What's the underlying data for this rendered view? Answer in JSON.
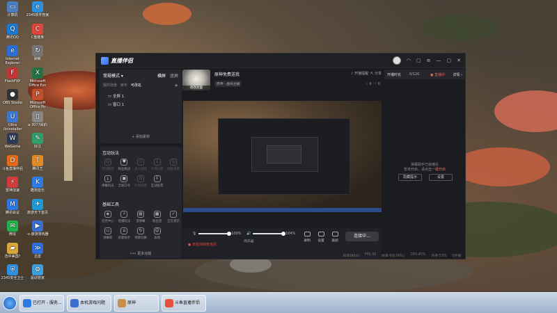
{
  "desktop": {
    "icons": [
      {
        "label": "计算机",
        "name": "computer-icon",
        "glyph": "▭",
        "color": "#4c7fc2"
      },
      {
        "label": "2345软件管家",
        "name": "software-manager-icon",
        "glyph": "e",
        "color": "#2f8fe0"
      },
      {
        "label": "腾讯QQ",
        "name": "qq-icon",
        "glyph": "Q",
        "color": "#1a7ad1"
      },
      {
        "label": "C盘瘦身",
        "name": "disk-cleanup-icon",
        "glyph": "C",
        "color": "#e0453a"
      },
      {
        "label": "Internet Explorer",
        "name": "ie-icon",
        "glyph": "e",
        "color": "#2a6fd6"
      },
      {
        "label": "刷新",
        "name": "refresh-icon",
        "glyph": "↻",
        "color": "#777"
      },
      {
        "label": "FlashFXP",
        "name": "flashfxp-icon",
        "glyph": "F",
        "color": "#c23535"
      },
      {
        "label": "Microsoft Office Exc",
        "name": "excel-icon",
        "glyph": "X",
        "color": "#217346"
      },
      {
        "label": "OBS Studio",
        "name": "obs-icon",
        "glyph": "●",
        "color": "#333"
      },
      {
        "label": "Microsoft Office Po",
        "name": "powerpoint-icon",
        "glyph": "P",
        "color": "#c4502b"
      },
      {
        "label": "Ultra Uninstaller",
        "name": "uninstaller-icon",
        "glyph": "U",
        "color": "#3b78d0"
      },
      {
        "label": "a-3077尚的",
        "name": "file-icon",
        "glyph": "▯",
        "color": "#888"
      },
      {
        "label": "WeGame",
        "name": "wegame-icon",
        "glyph": "W",
        "color": "#2d3a55"
      },
      {
        "label": "好注",
        "name": "note-icon",
        "glyph": "✎",
        "color": "#2f9f6d"
      },
      {
        "label": "斗鱼直播伴侣",
        "name": "douyu-icon",
        "glyph": "D",
        "color": "#e56a1a"
      },
      {
        "label": "腾讯王",
        "name": "tencent-app-icon",
        "glyph": "T",
        "color": "#e38b24"
      },
      {
        "label": "雷神加速",
        "name": "accelerator-icon",
        "glyph": "⚡",
        "color": "#d23b3b"
      },
      {
        "label": "酷狗音乐",
        "name": "kugou-icon",
        "glyph": "K",
        "color": "#2b7de9"
      },
      {
        "label": "腾讯会议",
        "name": "meeting-icon",
        "glyph": "M",
        "color": "#2e77e6"
      },
      {
        "label": "旅游天下首页",
        "name": "travel-icon",
        "glyph": "✈",
        "color": "#1e9bd7"
      },
      {
        "label": "微信",
        "name": "wechat-icon",
        "glyph": "✉",
        "color": "#21b24b"
      },
      {
        "label": "-x-旅游游戏器",
        "name": "game-launcher-icon",
        "glyph": "▶",
        "color": "#3a6fd0"
      },
      {
        "label": "选中美国?",
        "name": "folder-icon",
        "glyph": "▰",
        "color": "#d8a63a"
      },
      {
        "label": "迅雷",
        "name": "xunlei-icon",
        "glyph": "≫",
        "color": "#2c6ee0"
      },
      {
        "label": "2345安全卫士",
        "name": "security-icon",
        "glyph": "⛨",
        "color": "#2f8fe0"
      },
      {
        "label": "驱动管家",
        "name": "driver-icon",
        "glyph": "⚙",
        "color": "#3aa1e0"
      }
    ]
  },
  "app": {
    "title": "直播伴侣",
    "window_controls": {
      "headset": "◠",
      "chat": "▢",
      "menu": "≡",
      "minimize": "—",
      "maximize": "▢",
      "close": "✕"
    },
    "left": {
      "mode_label": "常规模式 ▾",
      "mode_tabs": [
        "横屏",
        "竖屏"
      ],
      "sub_tabs": [
        "我的场景",
        "荣布",
        "可改名"
      ],
      "plus": "+",
      "scenes": [
        "全屏 1",
        "窗口 1"
      ],
      "add_source": "+ 添加素材",
      "interactive_title": "互动玩法",
      "interactive_tools": [
        {
          "label": "连线管理",
          "glyph": "☺",
          "dim": true
        },
        {
          "label": "粉丝挑战",
          "glyph": "⛊",
          "dim": false
        },
        {
          "label": "多人连线",
          "glyph": "⚇",
          "dim": true
        },
        {
          "label": "礼物心愿",
          "glyph": "↓",
          "dim": true
        },
        {
          "label": "超级连麦",
          "glyph": "◎",
          "dim": true
        },
        {
          "label": "弹幕玩法",
          "glyph": "⤓",
          "dim": false
        },
        {
          "label": "全屏口令",
          "glyph": "▣",
          "dim": false
        },
        {
          "label": "礼物投票",
          "glyph": "⊡",
          "dim": true
        },
        {
          "label": "互动投票",
          "glyph": "⇩",
          "dim": false
        }
      ],
      "basic_title": "基础工具",
      "basic_tools": [
        {
          "label": "任务中心",
          "glyph": "◈",
          "dim": false
        },
        {
          "label": "直播玩法",
          "glyph": "⚡",
          "dim": false
        },
        {
          "label": "流弹幕",
          "glyph": "▤",
          "dim": false
        },
        {
          "label": "粉丝团",
          "glyph": "▦",
          "dim": false
        },
        {
          "label": "正在提示",
          "glyph": "✓",
          "dim": false
        },
        {
          "label": "弹幕库",
          "glyph": "▭",
          "dim": false
        },
        {
          "label": "房管助手",
          "glyph": "⌂",
          "dim": false
        },
        {
          "label": "场景切换",
          "glyph": "↻",
          "dim": false
        },
        {
          "label": "表情",
          "glyph": "☺",
          "dim": false
        }
      ],
      "more": "••• 更多功能"
    },
    "room": {
      "cover_caption": "修改封面",
      "title": "原神免费送我",
      "subtitle": "原神 · 虚拟主播",
      "notice": "开播提醒",
      "share": "分享",
      "like_count": "0",
      "heart_count": "0"
    },
    "controls": {
      "mic_percent": "100%",
      "speaker_percent": "104%",
      "mic_value": 1.0,
      "speaker_value": 1.0,
      "speaker_label": "扬声器",
      "warning": "未检测到麦克风",
      "buttons": [
        "录制",
        "设置",
        "美颜"
      ],
      "live_button": "连接中..."
    },
    "status": [
      "码率0Kb/s",
      "FPS:30",
      "帧率 0(0.00%)",
      "CPU:45%",
      "内存:53%",
      "0开播"
    ],
    "right": {
      "duration_label": "开播时长",
      "viewer": "0/120",
      "warning": "● 直播中",
      "detail": "详情 ›",
      "msg1": "弹幕助手已就绪在",
      "msg2_prefix": "暂未开启，请点击",
      "msg2_link": "一键开启",
      "btn_left": "隐藏提示",
      "btn_right": "设置"
    }
  },
  "taskbar": {
    "items": [
      {
        "label": "已打开 - 服务...",
        "color": "#2d7be0"
      },
      {
        "label": "本机游戏问题",
        "color": "#3a6fd0"
      },
      {
        "label": "原神",
        "color": "#c88f4a"
      },
      {
        "label": "斗鱼直播伴侣",
        "color": "#e5503a"
      }
    ]
  }
}
